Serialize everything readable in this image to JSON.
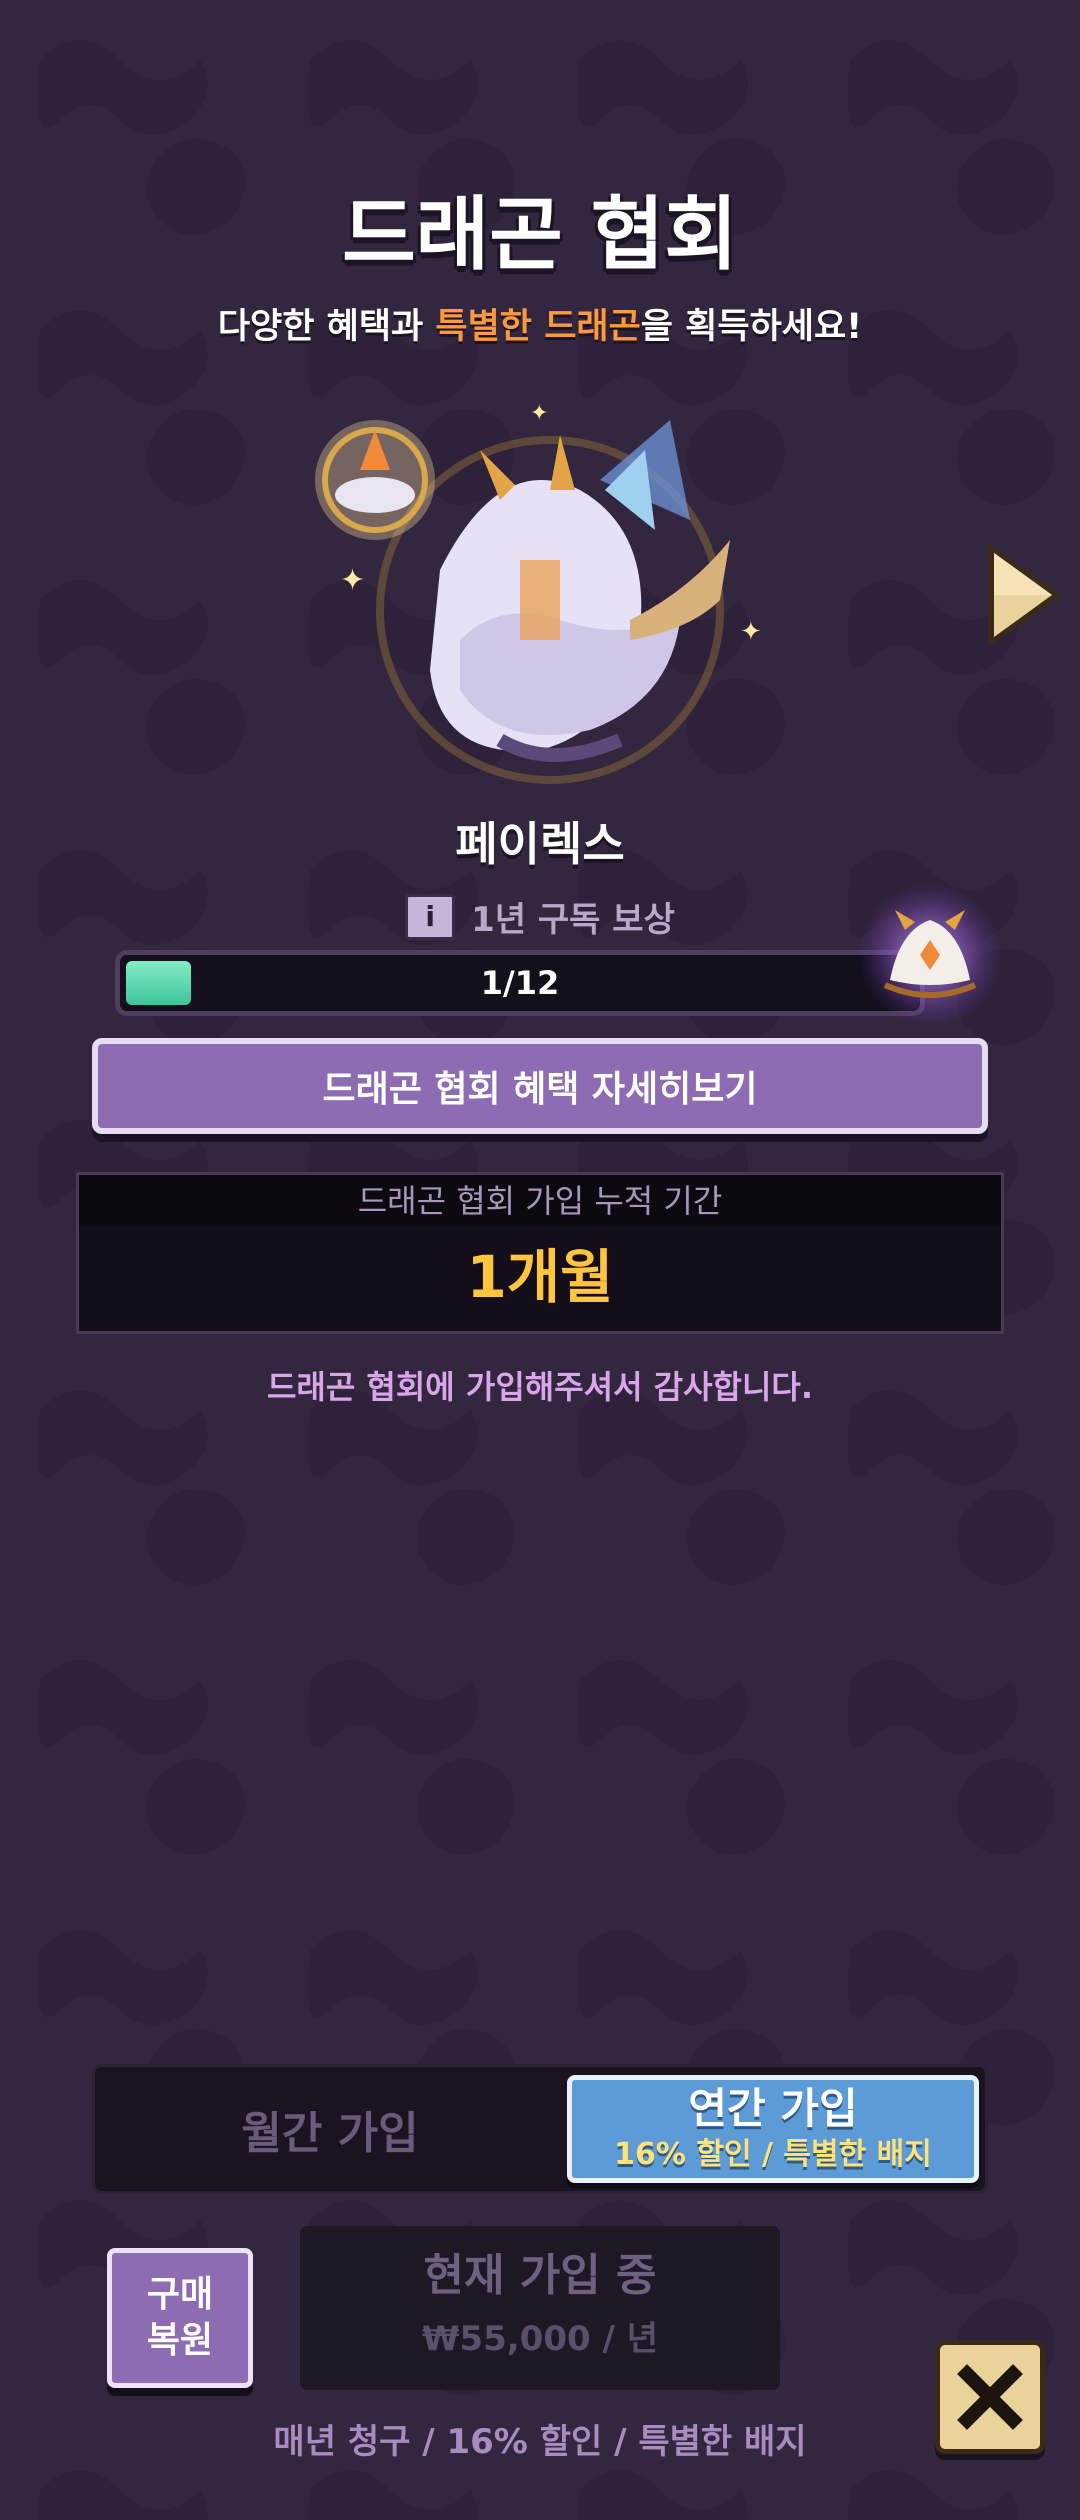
{
  "title": "드래곤 협회",
  "subtitle": {
    "before": "다양한 혜택과 ",
    "highlight": "특별한 드래곤",
    "after": "을 획득하세요!"
  },
  "dragon": {
    "name": "페이렉스"
  },
  "reward": {
    "info_icon": "i",
    "label": "1년 구독 보상",
    "progress_text": "1/12",
    "progress_fraction": 0.0833
  },
  "detail_button": "드래곤 협회 혜택 자세히보기",
  "membership_period": {
    "label": "드래곤 협회 가입 누적 기간",
    "value": "1개월"
  },
  "thanks": "드래곤 협회에 가입해주셔서 감사합니다.",
  "plans": {
    "monthly": "월간 가입",
    "yearly_title": "연간 가입",
    "yearly_sub": "16% 할인 / 특별한 배지",
    "selected": "yearly"
  },
  "restore_button": {
    "line1": "구매",
    "line2": "복원"
  },
  "current": {
    "status": "현재 가입 중",
    "price": "₩55,000 / 년"
  },
  "billing_note": "매년 청구 / 16% 할인 / 특별한 배지",
  "icons": {
    "next": "arrow-right-icon",
    "close": "close-icon",
    "info": "info-icon",
    "badge": "dragon-badge-icon"
  },
  "colors": {
    "background": "#33263f",
    "accent_orange": "#ff9a3c",
    "period_value": "#ffc53d",
    "progress_fill": "#3dc59c",
    "button_purple": "#8d6cb3",
    "yearly_blue": "#5c9bd6"
  }
}
